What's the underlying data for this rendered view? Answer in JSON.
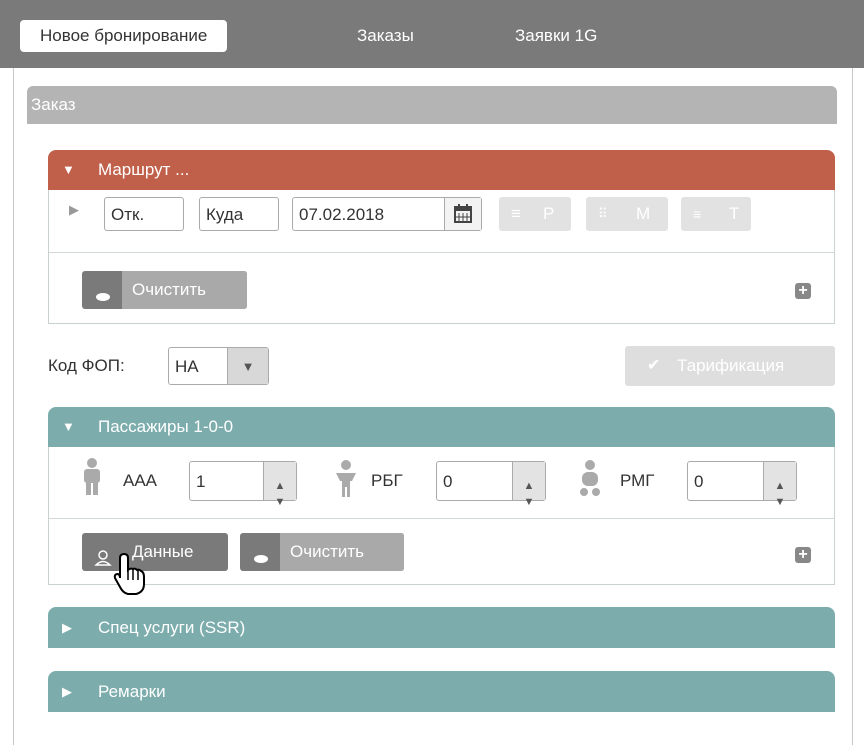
{
  "tabs": [
    {
      "label": "Новое бронирование"
    },
    {
      "label": "Заказы"
    },
    {
      "label": "Заявки 1G"
    }
  ],
  "panel_title": "Заказ",
  "route": {
    "title": "Маршрут ...",
    "from_value": "Отк.",
    "to_value": "Куда",
    "date_value": "07.02.2018",
    "btn_p": "P",
    "btn_m": "M",
    "btn_t": "T",
    "clear_label": "Очистить"
  },
  "fop": {
    "label": "Код ФОП:",
    "value": "НА",
    "tarif_label": "Тарификация"
  },
  "passengers": {
    "title": "Пассажиры 1-0-0",
    "types": [
      {
        "label": "AAA",
        "value": "1"
      },
      {
        "label": "РБГ",
        "value": "0"
      },
      {
        "label": "РМГ",
        "value": "0"
      }
    ],
    "data_label": "Данные",
    "clear_label": "Очистить"
  },
  "ssr": {
    "title": "Спец услуги (SSR)"
  },
  "remarks": {
    "title": "Ремарки"
  },
  "colors": {
    "route_header": "#c0604a",
    "teal_header": "#7cacac",
    "button_dark": "#7a7a7a",
    "button_disabled": "#e2e2e2"
  }
}
